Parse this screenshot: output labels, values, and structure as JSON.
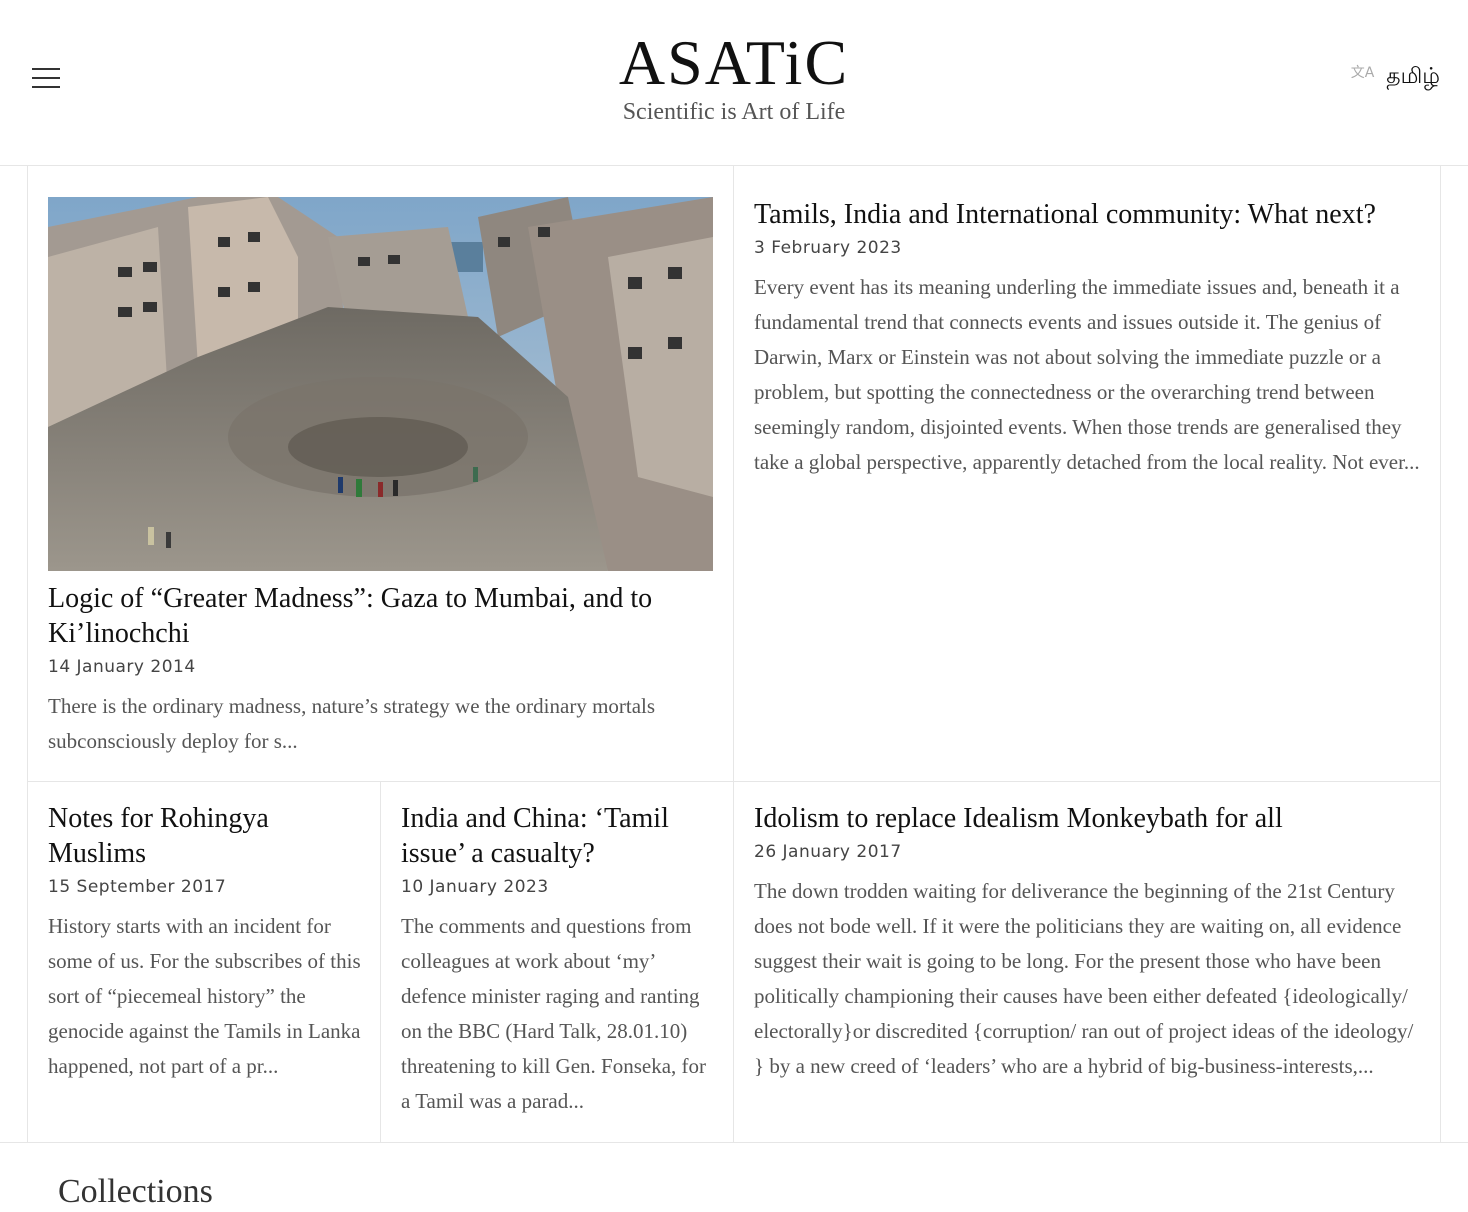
{
  "header": {
    "site_title": "ASATiC",
    "tagline": "Scientific is Art of Life",
    "language_label": "தமிழ்",
    "language_icon": "translate-icon"
  },
  "posts": [
    {
      "title": "Logic of “Greater Madness”: Gaza to Mumbai, and to Ki’linochchi",
      "date": "14 January 2014",
      "excerpt": "There is the ordinary madness, nature’s strategy we the ordinary mortals subconsciously deploy for s...",
      "image_alt": "rubble of destroyed buildings with people standing in a crater"
    },
    {
      "title": "Tamils, India and International community: What next?",
      "date": "3 February 2023",
      "excerpt": "Every event has its meaning underling the immediate issues and, beneath it a fundamental trend that connects events and issues outside it. The genius of Darwin, Marx or Einstein was not about solving the immediate puzzle or a problem, but spotting the connectedness or the overarching trend between seemingly random, disjointed events. When those trends are generalised they take a global perspective, apparently detached from the local reality. Not ever..."
    },
    {
      "title": "Notes for Rohingya Muslims",
      "date": "15 September 2017",
      "excerpt": "History starts with an incident for some of us. For the subscribes of this sort of “piecemeal history” the genocide against the Tamils in Lanka happened, not part of a pr..."
    },
    {
      "title": "India and China: ‘Tamil issue’ a casualty?",
      "date": "10 January 2023",
      "excerpt": "The comments and questions from colleagues at work about ‘my’ defence minister raging and ranting on the BBC (Hard Talk, 28.01.10) threatening to kill Gen. Fonseka, for a Tamil was a parad..."
    },
    {
      "title": "Idolism to replace Idealism Monkeybath for all",
      "date": "26 January 2017",
      "excerpt": "The down trodden waiting for deliverance the beginning of the 21st Century does not bode well. If it were the politicians they are waiting on, all evidence suggest their wait is going to be long. For the present those who have been politically championing their causes have been either defeated {ideologically/ electorally}or discredited {corruption/ ran out of project ideas of the ideology/ } by a new creed of ‘leaders’ who are a hybrid of big-business-interests,..."
    }
  ],
  "collections_heading": "Collections"
}
